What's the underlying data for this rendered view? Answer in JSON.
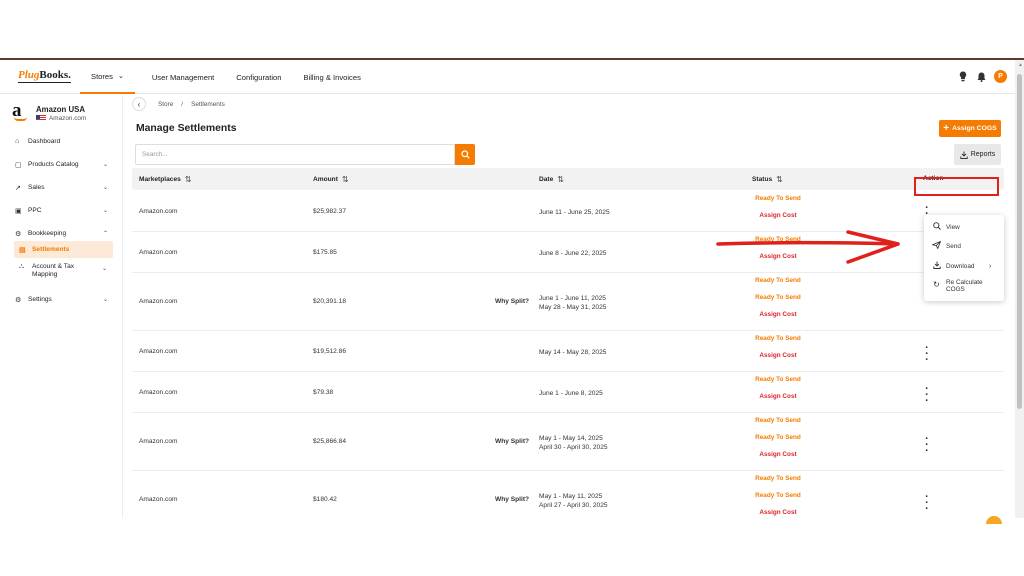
{
  "topnav": {
    "logo_prefix": "Plug",
    "logo_suffix": "Books.",
    "links": [
      {
        "label": "Stores",
        "active": true,
        "has_chevron": true
      },
      {
        "label": "User Management"
      },
      {
        "label": "Configuration"
      },
      {
        "label": "Billing & Invoices"
      }
    ],
    "avatar_initial": "P",
    "accent_color": "#f57c00"
  },
  "sidebar": {
    "store_name": "Amazon USA",
    "store_marketplace": "Amazon.com",
    "items": [
      {
        "label": "Dashboard",
        "icon": "home-icon"
      },
      {
        "label": "Products Catalog",
        "icon": "catalog-icon",
        "chevron": "down"
      },
      {
        "label": "Sales",
        "icon": "sales-chart-icon",
        "chevron": "down"
      },
      {
        "label": "PPC",
        "icon": "ppc-icon",
        "chevron": "down"
      },
      {
        "label": "Bookkeeping",
        "icon": "bookkeeping-icon",
        "chevron": "up"
      },
      {
        "label": "Settlements",
        "icon": "settlements-icon",
        "active": true
      },
      {
        "label": "Account & Tax",
        "label2": "Mapping",
        "icon": "mapping-icon",
        "chevron": "down"
      },
      {
        "label": "Settings",
        "icon": "gear-icon",
        "chevron": "down"
      }
    ]
  },
  "breadcrumb": {
    "items": [
      "Store",
      "/",
      "Settlements"
    ]
  },
  "page": {
    "title": "Manage Settlements",
    "assign_cogs_label": "Assign COGS",
    "search_placeholder": "Search...",
    "reports_label": "Reports"
  },
  "table": {
    "columns": [
      "Marketplaces",
      "Amount",
      "Date",
      "Status",
      "Action"
    ],
    "rows": [
      {
        "marketplace": "Amazon.com",
        "amount": "$25,982.37",
        "why_split": "",
        "dates": [
          "June 11 - June 25, 2025"
        ],
        "statuses": [
          "Ready To Send",
          "Assign Cost"
        ]
      },
      {
        "marketplace": "Amazon.com",
        "amount": "$175.85",
        "why_split": "",
        "dates": [
          "June 8 - June 22, 2025"
        ],
        "statuses": [
          "Ready To Send",
          "Assign Cost"
        ]
      },
      {
        "marketplace": "Amazon.com",
        "amount": "$20,391.18",
        "why_split": "Why Split?",
        "dates": [
          "June 1 - June 11, 2025",
          "May 28 - May 31, 2025"
        ],
        "statuses": [
          "Ready To Send",
          "Ready To Send",
          "Assign Cost"
        ]
      },
      {
        "marketplace": "Amazon.com",
        "amount": "$19,512.86",
        "why_split": "",
        "dates": [
          "May 14 - May 28, 2025"
        ],
        "statuses": [
          "Ready To Send",
          "Assign Cost"
        ]
      },
      {
        "marketplace": "Amazon.com",
        "amount": "$79.38",
        "why_split": "",
        "dates": [
          "June 1 - June 8, 2025"
        ],
        "statuses": [
          "Ready To Send",
          "Assign Cost"
        ]
      },
      {
        "marketplace": "Amazon.com",
        "amount": "$25,866.84",
        "why_split": "Why Split?",
        "dates": [
          "May 1 - May 14, 2025",
          "April 30 - April 30, 2025"
        ],
        "statuses": [
          "Ready To Send",
          "Ready To Send",
          "Assign Cost"
        ]
      },
      {
        "marketplace": "Amazon.com",
        "amount": "$180.42",
        "why_split": "Why Split?",
        "dates": [
          "May 1 - May 11, 2025",
          "April 27 - April 30, 2025"
        ],
        "statuses": [
          "Ready To Send",
          "Ready To Send",
          "Assign Cost"
        ]
      }
    ],
    "status_colors": {
      "Ready To Send": "#f57c00",
      "Assign Cost": "#d9262a"
    }
  },
  "action_menu": {
    "items": [
      {
        "label": "View",
        "icon": "search-icon"
      },
      {
        "label": "Send",
        "icon": "send-icon",
        "highlighted": true
      },
      {
        "label": "Download",
        "icon": "download-icon",
        "has_submenu": true
      },
      {
        "label": "Re Calculate",
        "label2": "COGS",
        "icon": "refresh-icon"
      }
    ],
    "highlight_color": "#e0201b"
  }
}
